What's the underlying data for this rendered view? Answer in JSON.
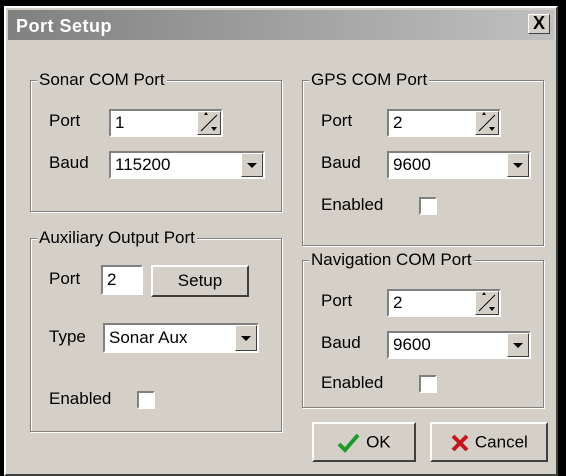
{
  "window": {
    "title": "Port Setup",
    "close_label": "X"
  },
  "sonar": {
    "legend": "Sonar COM Port",
    "port_label": "Port",
    "port_value": "1",
    "baud_label": "Baud",
    "baud_value": "115200"
  },
  "gps": {
    "legend": "GPS COM Port",
    "port_label": "Port",
    "port_value": "2",
    "baud_label": "Baud",
    "baud_value": "9600",
    "enabled_label": "Enabled"
  },
  "aux": {
    "legend": "Auxiliary Output Port",
    "port_label": "Port",
    "port_value": "2",
    "setup_label": "Setup",
    "type_label": "Type",
    "type_value": "Sonar Aux",
    "enabled_label": "Enabled"
  },
  "nav": {
    "legend": "Navigation COM Port",
    "port_label": "Port",
    "port_value": "2",
    "baud_label": "Baud",
    "baud_value": "9600",
    "enabled_label": "Enabled"
  },
  "buttons": {
    "ok_label": "OK",
    "cancel_label": "Cancel"
  }
}
